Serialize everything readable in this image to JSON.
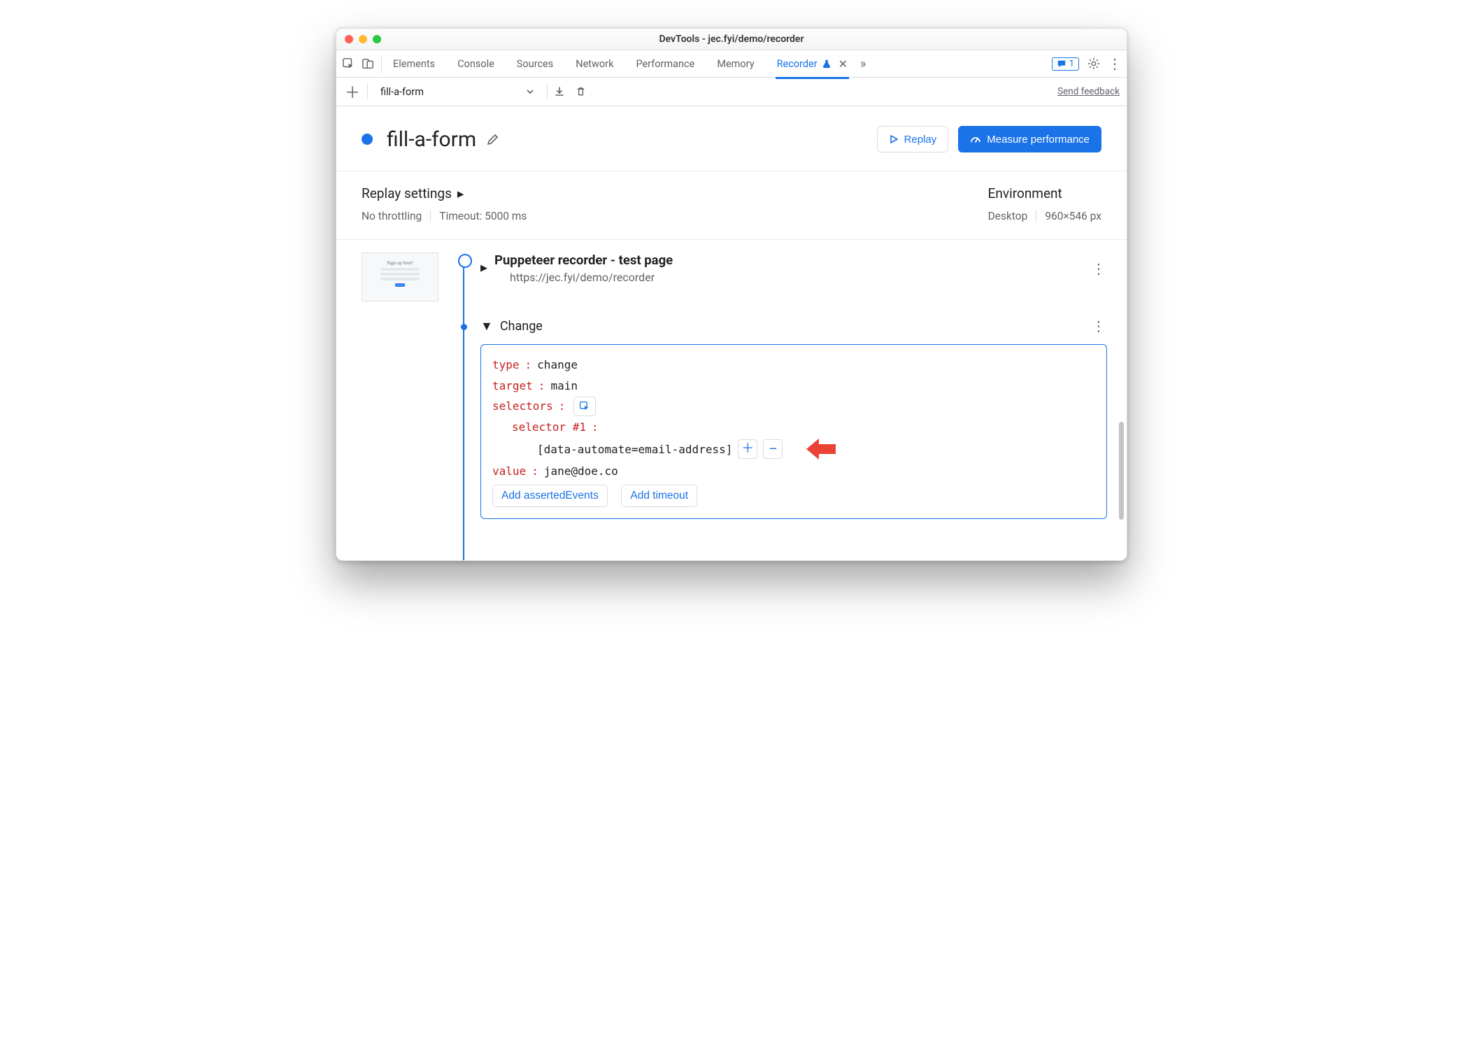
{
  "window": {
    "title": "DevTools - jec.fyi/demo/recorder"
  },
  "tabs": {
    "items": [
      {
        "label": "Elements",
        "active": false
      },
      {
        "label": "Console",
        "active": false
      },
      {
        "label": "Sources",
        "active": false
      },
      {
        "label": "Network",
        "active": false
      },
      {
        "label": "Performance",
        "active": false
      },
      {
        "label": "Memory",
        "active": false
      },
      {
        "label": "Recorder",
        "active": true,
        "experiment": true,
        "closable": true
      }
    ],
    "overflow_glyph": "»",
    "issues_count": "1"
  },
  "toolbar2": {
    "recording_selector": "fill-a-form",
    "send_feedback": "Send feedback"
  },
  "header": {
    "recording_name": "fill-a-form",
    "replay_label": "Replay",
    "measure_label": "Measure performance"
  },
  "settings": {
    "replay_title": "Replay settings",
    "throttling": "No throttling",
    "timeout": "Timeout: 5000 ms",
    "environment_title": "Environment",
    "device": "Desktop",
    "viewport": "960×546 px"
  },
  "steps": {
    "start": {
      "title": "Puppeteer recorder - test page",
      "url": "https://jec.fyi/demo/recorder"
    },
    "change": {
      "label": "Change",
      "keys": {
        "type_k": "type",
        "type_v": "change",
        "target_k": "target",
        "target_v": "main",
        "selectors_k": "selectors",
        "selector1_k": "selector #1",
        "selector1_v": "[data-automate=email-address]",
        "value_k": "value",
        "value_v": "jane@doe.co"
      },
      "add_asserted": "Add assertedEvents",
      "add_timeout": "Add timeout"
    }
  }
}
